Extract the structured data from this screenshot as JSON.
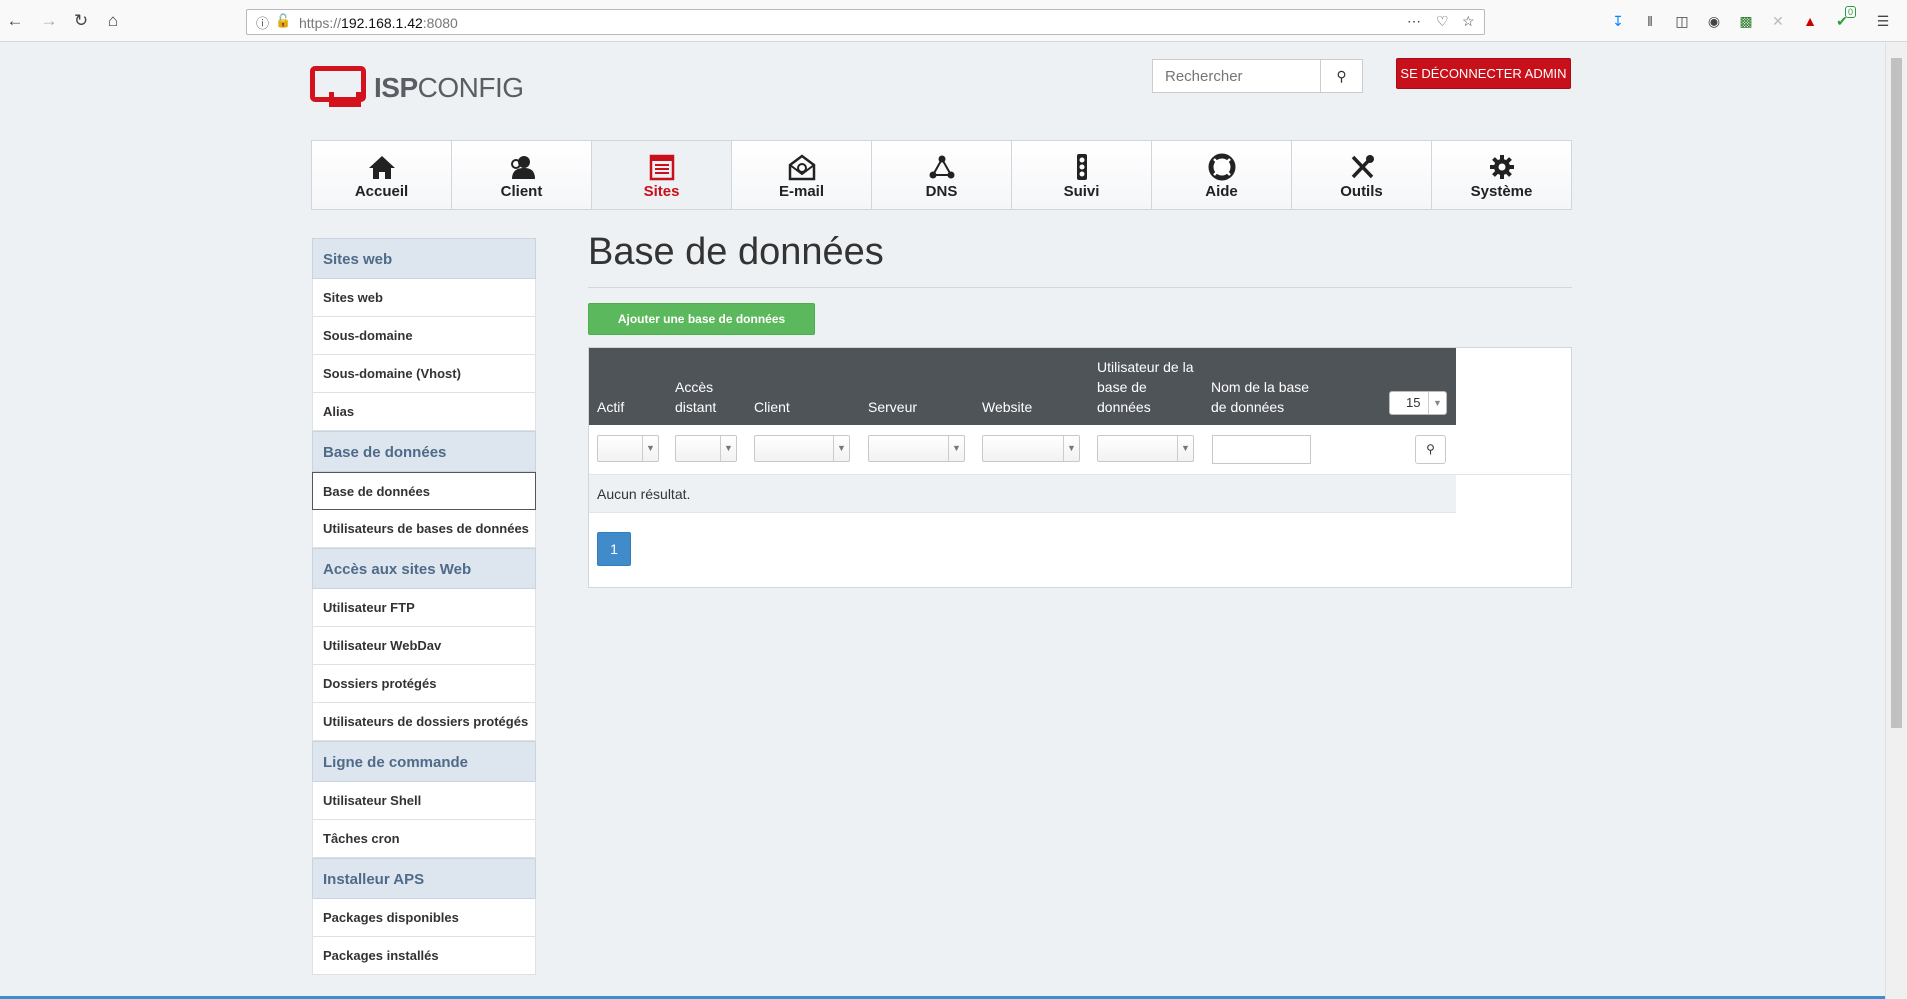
{
  "browser": {
    "url_prefix": "https://",
    "url_host": "192.168.1.42",
    "url_port": ":8080",
    "addon_badge": "0"
  },
  "header": {
    "logo_bold": "ISP",
    "logo_light": "CONFIG",
    "search_placeholder": "Rechercher",
    "logout_label": "SE DÉCONNECTER ADMIN"
  },
  "nav": {
    "tabs": [
      {
        "label": "Accueil",
        "icon": "home-icon"
      },
      {
        "label": "Client",
        "icon": "client-icon"
      },
      {
        "label": "Sites",
        "icon": "sites-icon",
        "active": true
      },
      {
        "label": "E-mail",
        "icon": "email-icon"
      },
      {
        "label": "DNS",
        "icon": "dns-icon"
      },
      {
        "label": "Suivi",
        "icon": "monitor-icon"
      },
      {
        "label": "Aide",
        "icon": "help-icon"
      },
      {
        "label": "Outils",
        "icon": "tools-icon"
      },
      {
        "label": "Système",
        "icon": "system-icon"
      }
    ]
  },
  "sidebar": {
    "sections": [
      {
        "title": "Sites web",
        "items": [
          "Sites web",
          "Sous-domaine",
          "Sous-domaine (Vhost)",
          "Alias"
        ]
      },
      {
        "title": "Base de données",
        "items": [
          "Base de données",
          "Utilisateurs de bases de données"
        ]
      },
      {
        "title": "Accès aux sites Web",
        "items": [
          "Utilisateur FTP",
          "Utilisateur WebDav",
          "Dossiers protégés",
          "Utilisateurs de dossiers protégés"
        ]
      },
      {
        "title": "Ligne de commande",
        "items": [
          "Utilisateur Shell",
          "Tâches cron"
        ]
      },
      {
        "title": "Installeur APS",
        "items": [
          "Packages disponibles",
          "Packages installés"
        ]
      }
    ],
    "active_item": "Base de données"
  },
  "main": {
    "title": "Base de données",
    "add_button": "Ajouter une base de données",
    "columns": {
      "actif": "Actif",
      "acces_1": "Accès",
      "acces_2": "distant",
      "client": "Client",
      "serveur": "Serveur",
      "website": "Website",
      "user_1": "Utilisateur de la",
      "user_2": "base de",
      "user_3": "données",
      "dbname_1": "Nom de la base",
      "dbname_2": "de données"
    },
    "per_page": "15",
    "no_result": "Aucun résultat.",
    "page_number": "1"
  }
}
